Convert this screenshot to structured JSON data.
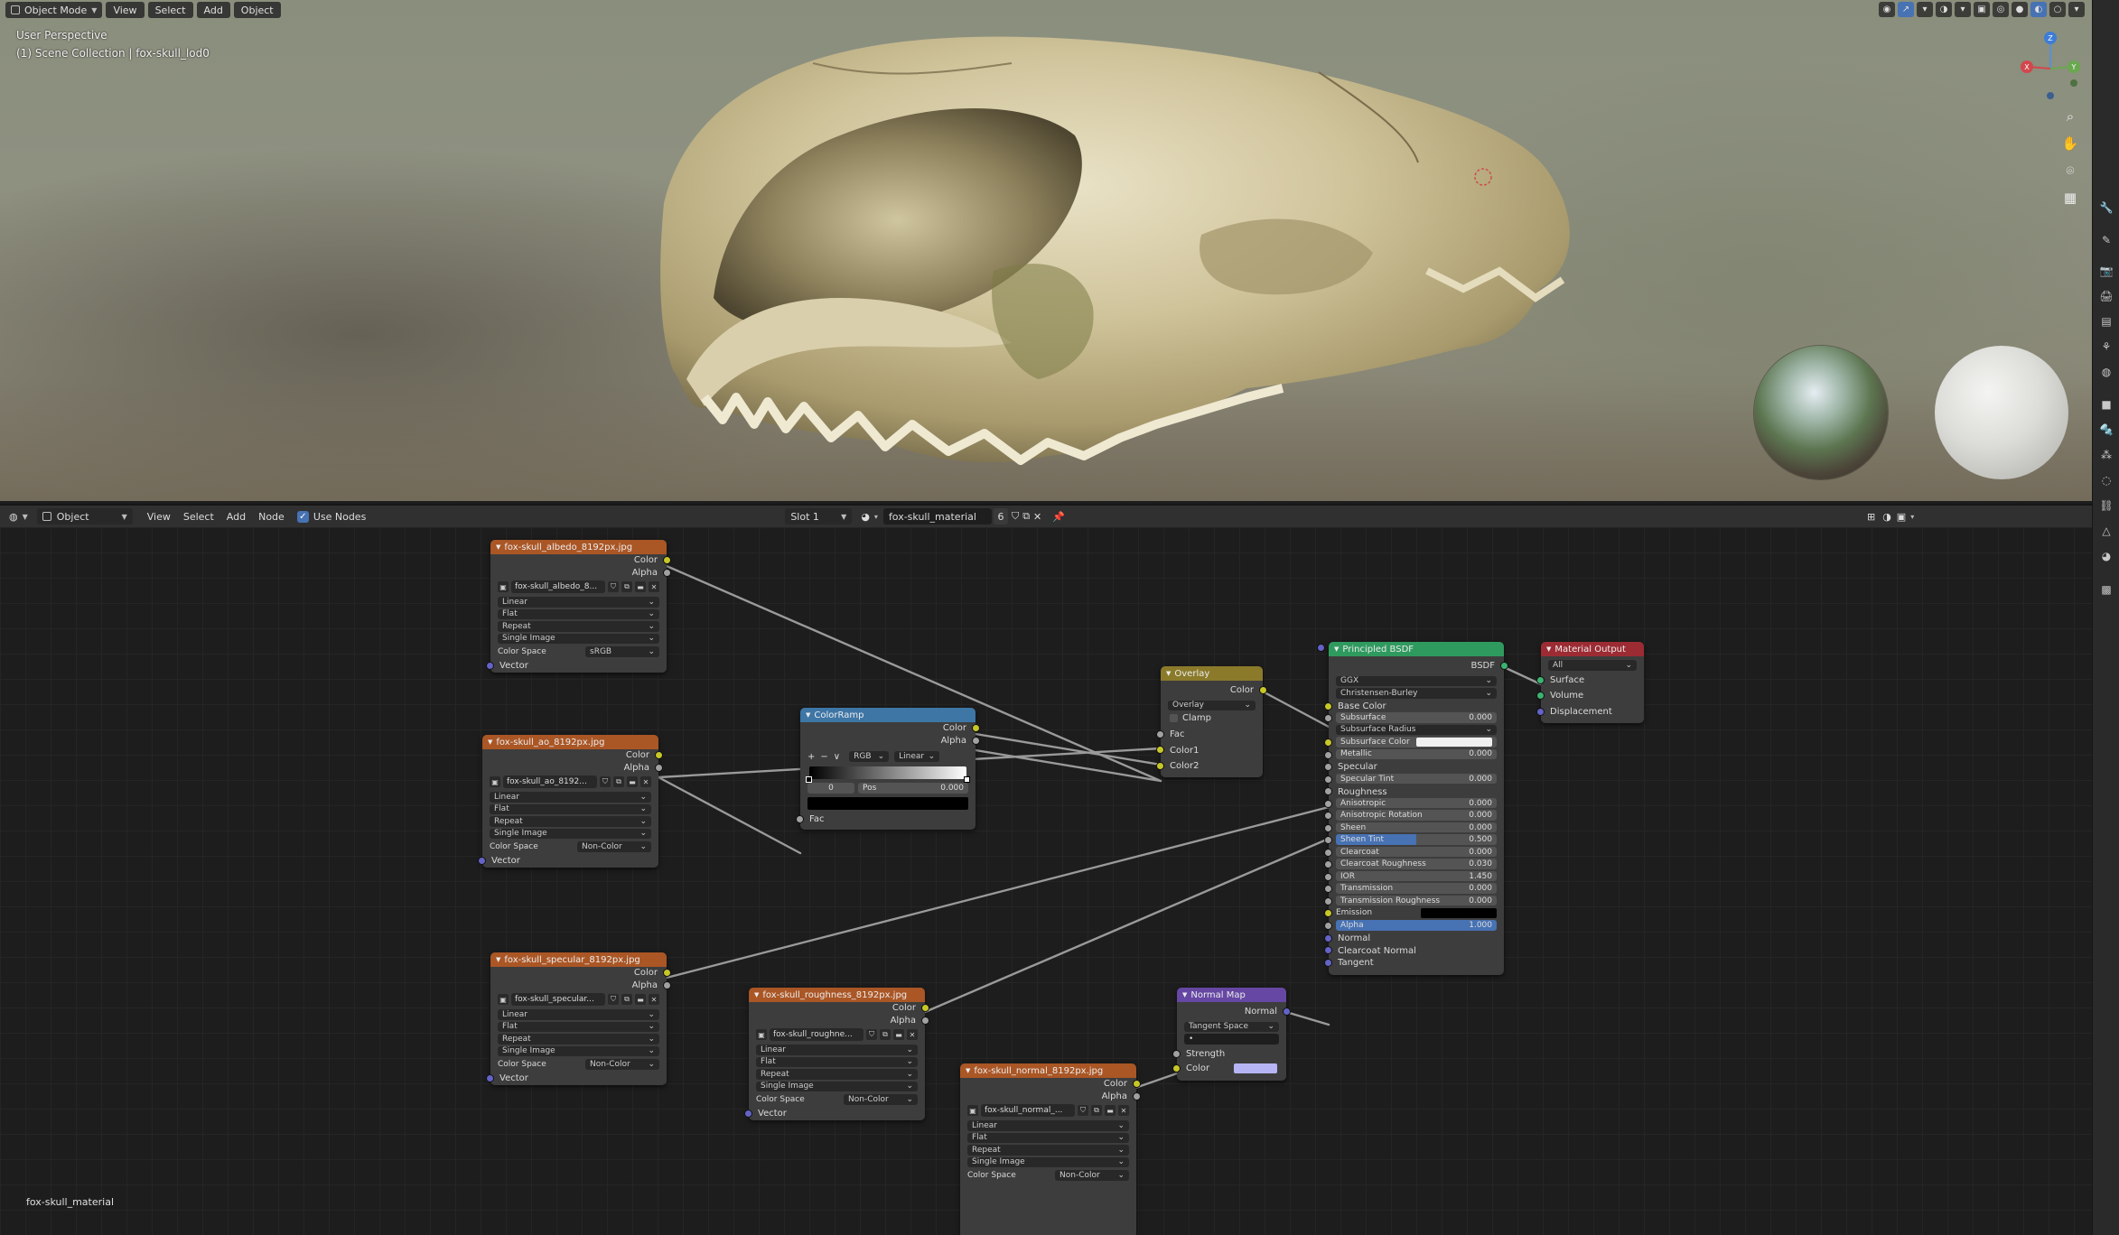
{
  "viewport": {
    "mode_label": "Object Mode",
    "menu": [
      "View",
      "Select",
      "Add",
      "Object"
    ],
    "perspective_label": "User Perspective",
    "collection_label": "(1) Scene Collection | fox-skull_lod0",
    "gizmo_axes": {
      "x": "X",
      "y": "Y",
      "z": "Z"
    }
  },
  "node_editor_header": {
    "editor_type": "Object",
    "menu": [
      "View",
      "Select",
      "Add",
      "Node"
    ],
    "use_nodes_label": "Use Nodes",
    "use_nodes_checked": true,
    "slot": "Slot 1",
    "material_name": "fox-skull_material",
    "user_count": "6"
  },
  "nodes": {
    "albedo": {
      "title": "fox-skull_albedo_8192px.jpg",
      "outputs": [
        "Color",
        "Alpha"
      ],
      "image_name": "fox-skull_albedo_8...",
      "interpolation": "Linear",
      "projection": "Flat",
      "extension": "Repeat",
      "source": "Single Image",
      "color_space_label": "Color Space",
      "color_space": "sRGB",
      "input": "Vector"
    },
    "ao": {
      "title": "fox-skull_ao_8192px.jpg",
      "outputs": [
        "Color",
        "Alpha"
      ],
      "image_name": "fox-skull_ao_8192...",
      "interpolation": "Linear",
      "projection": "Flat",
      "extension": "Repeat",
      "source": "Single Image",
      "color_space_label": "Color Space",
      "color_space": "Non-Color",
      "input": "Vector"
    },
    "specular": {
      "title": "fox-skull_specular_8192px.jpg",
      "outputs": [
        "Color",
        "Alpha"
      ],
      "image_name": "fox-skull_specular...",
      "interpolation": "Linear",
      "projection": "Flat",
      "extension": "Repeat",
      "source": "Single Image",
      "color_space_label": "Color Space",
      "color_space": "Non-Color",
      "input": "Vector"
    },
    "roughness": {
      "title": "fox-skull_roughness_8192px.jpg",
      "outputs": [
        "Color",
        "Alpha"
      ],
      "image_name": "fox-skull_roughne...",
      "interpolation": "Linear",
      "projection": "Flat",
      "extension": "Repeat",
      "source": "Single Image",
      "color_space_label": "Color Space",
      "color_space": "Non-Color",
      "input": "Vector"
    },
    "normal_img": {
      "title": "fox-skull_normal_8192px.jpg",
      "outputs": [
        "Color",
        "Alpha"
      ],
      "image_name": "fox-skull_normal_...",
      "interpolation": "Linear",
      "projection": "Flat",
      "extension": "Repeat",
      "source": "Single Image",
      "color_space_label": "Color Space",
      "color_space": "Non-Color"
    },
    "colorramp": {
      "title": "ColorRamp",
      "outputs": [
        "Color",
        "Alpha"
      ],
      "add": "+",
      "remove": "−",
      "menu": "∨",
      "color_mode": "RGB",
      "interpolation": "Linear",
      "stop_index": "0",
      "pos_label": "Pos",
      "pos_value": "0.000",
      "input": "Fac"
    },
    "overlay": {
      "title": "Overlay",
      "output": "Color",
      "blend": "Overlay",
      "clamp_label": "Clamp",
      "inputs": [
        "Fac",
        "Color1",
        "Color2"
      ]
    },
    "normalmap": {
      "title": "Normal Map",
      "output": "Normal",
      "space": "Tangent Space",
      "uv": "•",
      "inputs": [
        "Strength",
        "Color"
      ]
    },
    "bsdf": {
      "title": "Principled BSDF",
      "output": "BSDF",
      "distribution": "GGX",
      "subsurface_method": "Christensen-Burley",
      "base_color_label": "Base Color",
      "fields": [
        {
          "label": "Subsurface",
          "value": "0.000"
        },
        {
          "label": "Subsurface Radius",
          "value": ""
        },
        {
          "label": "Subsurface Color",
          "value": ""
        },
        {
          "label": "Metallic",
          "value": "0.000"
        }
      ],
      "specular_label": "Specular",
      "specular_tint": {
        "label": "Specular Tint",
        "value": "0.000"
      },
      "roughness_label": "Roughness",
      "fields2": [
        {
          "label": "Anisotropic",
          "value": "0.000"
        },
        {
          "label": "Anisotropic Rotation",
          "value": "0.000"
        },
        {
          "label": "Sheen",
          "value": "0.000"
        },
        {
          "label": "Sheen Tint",
          "value": "0.500",
          "fill": 0.5
        },
        {
          "label": "Clearcoat",
          "value": "0.000"
        },
        {
          "label": "Clearcoat Roughness",
          "value": "0.030"
        },
        {
          "label": "IOR",
          "value": "1.450"
        },
        {
          "label": "Transmission",
          "value": "0.000"
        },
        {
          "label": "Transmission Roughness",
          "value": "0.000"
        }
      ],
      "emission_label": "Emission",
      "alpha": {
        "label": "Alpha",
        "value": "1.000",
        "fill": 1.0
      },
      "tail_inputs": [
        "Normal",
        "Clearcoat Normal",
        "Tangent"
      ]
    },
    "output": {
      "title": "Material Output",
      "target": "All",
      "inputs": [
        "Surface",
        "Volume",
        "Displacement"
      ]
    }
  },
  "material_label": "fox-skull_material",
  "colors": {
    "image_header": "#aa5625",
    "converter_header": "#3e76a6",
    "color_header": "#8a7a2a",
    "shader_header": "#2f9a5e",
    "output_header": "#9c2b33",
    "vector_header": "#6647a3",
    "socket_color": "#c7c729",
    "socket_float": "#a1a1a1",
    "socket_vector": "#6363c7",
    "socket_shader": "#3cb371",
    "accent": "#4772b3"
  }
}
